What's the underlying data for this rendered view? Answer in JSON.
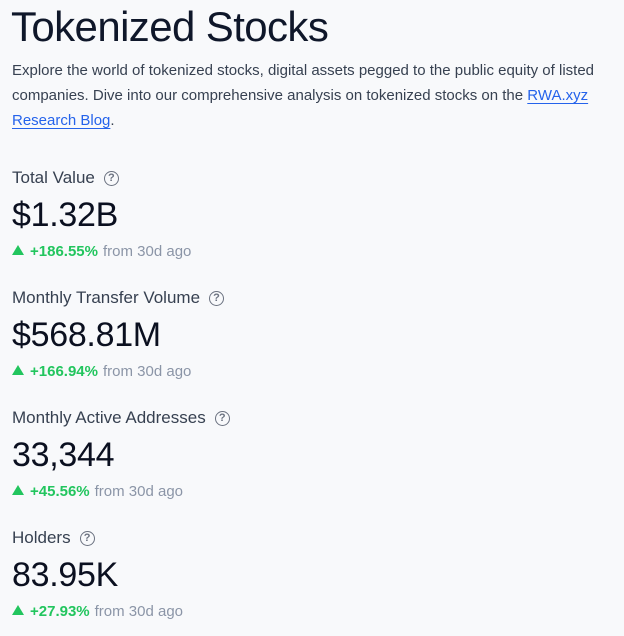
{
  "page": {
    "title": "Tokenized Stocks",
    "intro_text": "Explore the world of tokenized stocks, digital assets pegged to the public equity of listed companies. Dive into our comprehensive analysis on tokenized stocks on the",
    "link_text": "RWA.xyz Research Blog",
    "intro_suffix": "."
  },
  "metrics": [
    {
      "label": "Total Value",
      "value": "$1.32B",
      "change": "+186.55%",
      "suffix": "from 30d ago",
      "help_icon": "help-circle-icon",
      "trend_icon": "arrow-up-icon"
    },
    {
      "label": "Monthly Transfer Volume",
      "value": "$568.81M",
      "change": "+166.94%",
      "suffix": "from 30d ago",
      "help_icon": "help-circle-icon",
      "trend_icon": "arrow-up-icon"
    },
    {
      "label": "Monthly Active Addresses",
      "value": "33,344",
      "change": "+45.56%",
      "suffix": "from 30d ago",
      "help_icon": "help-circle-icon",
      "trend_icon": "arrow-up-icon"
    },
    {
      "label": "Holders",
      "value": "83.95K",
      "change": "+27.93%",
      "suffix": "from 30d ago",
      "help_icon": "help-circle-icon",
      "trend_icon": "arrow-up-icon"
    }
  ],
  "colors": {
    "background": "#f8f9fb",
    "text": "#111827",
    "link": "#2563eb",
    "positive": "#22c55e",
    "muted": "#8b95a7"
  }
}
